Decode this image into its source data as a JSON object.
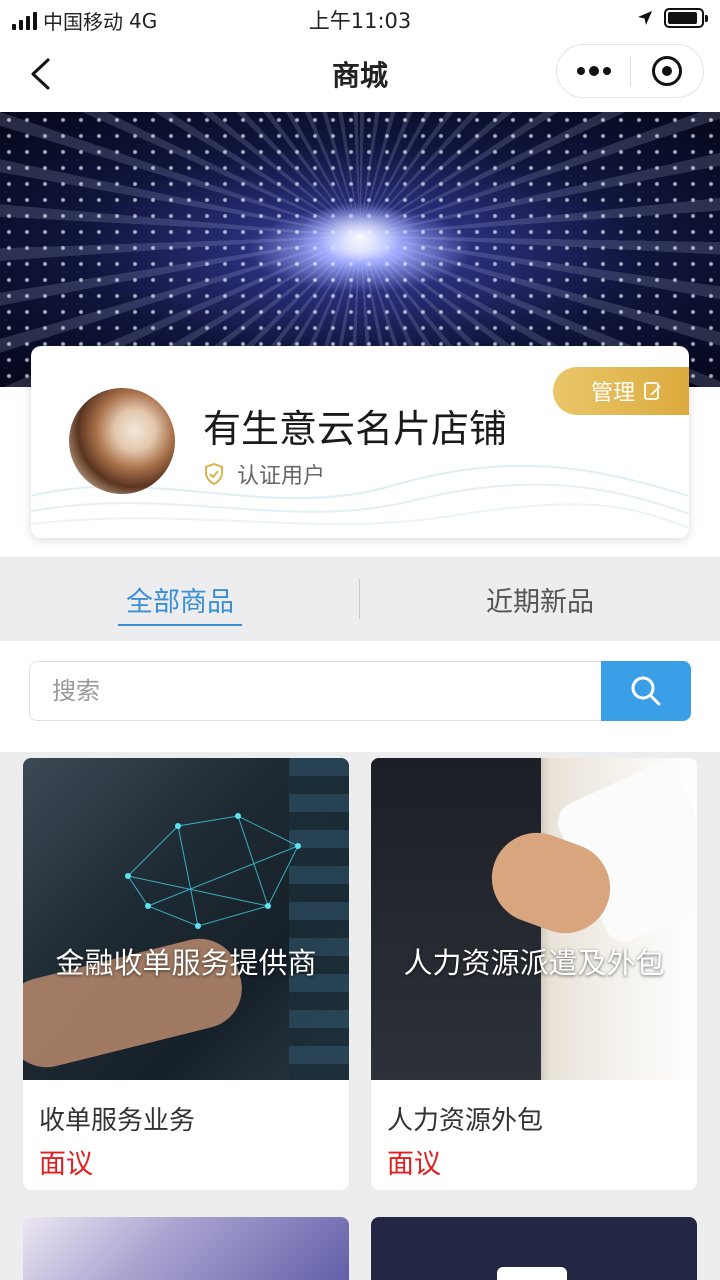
{
  "status_bar": {
    "carrier": "中国移动",
    "network": "4G",
    "time": "上午11:03",
    "battery_level": 0.9
  },
  "nav": {
    "title": "商城"
  },
  "shop": {
    "name": "有生意云名片店铺",
    "verified_label": "认证用户",
    "manage_label": "管理"
  },
  "tabs": [
    {
      "label": "全部商品",
      "active": true
    },
    {
      "label": "近期新品",
      "active": false
    }
  ],
  "search": {
    "placeholder": "搜索"
  },
  "products": [
    {
      "overlay": "金融收单服务提供商",
      "name": "收单服务业务",
      "price": "面议"
    },
    {
      "overlay": "人力资源派遣及外包",
      "name": "人力资源外包",
      "price": "面议"
    }
  ],
  "colors": {
    "accent": "#3a8fd4",
    "search_button": "#3b9fe8",
    "price": "#e02020",
    "manage_gold": "#dcaa3e"
  }
}
